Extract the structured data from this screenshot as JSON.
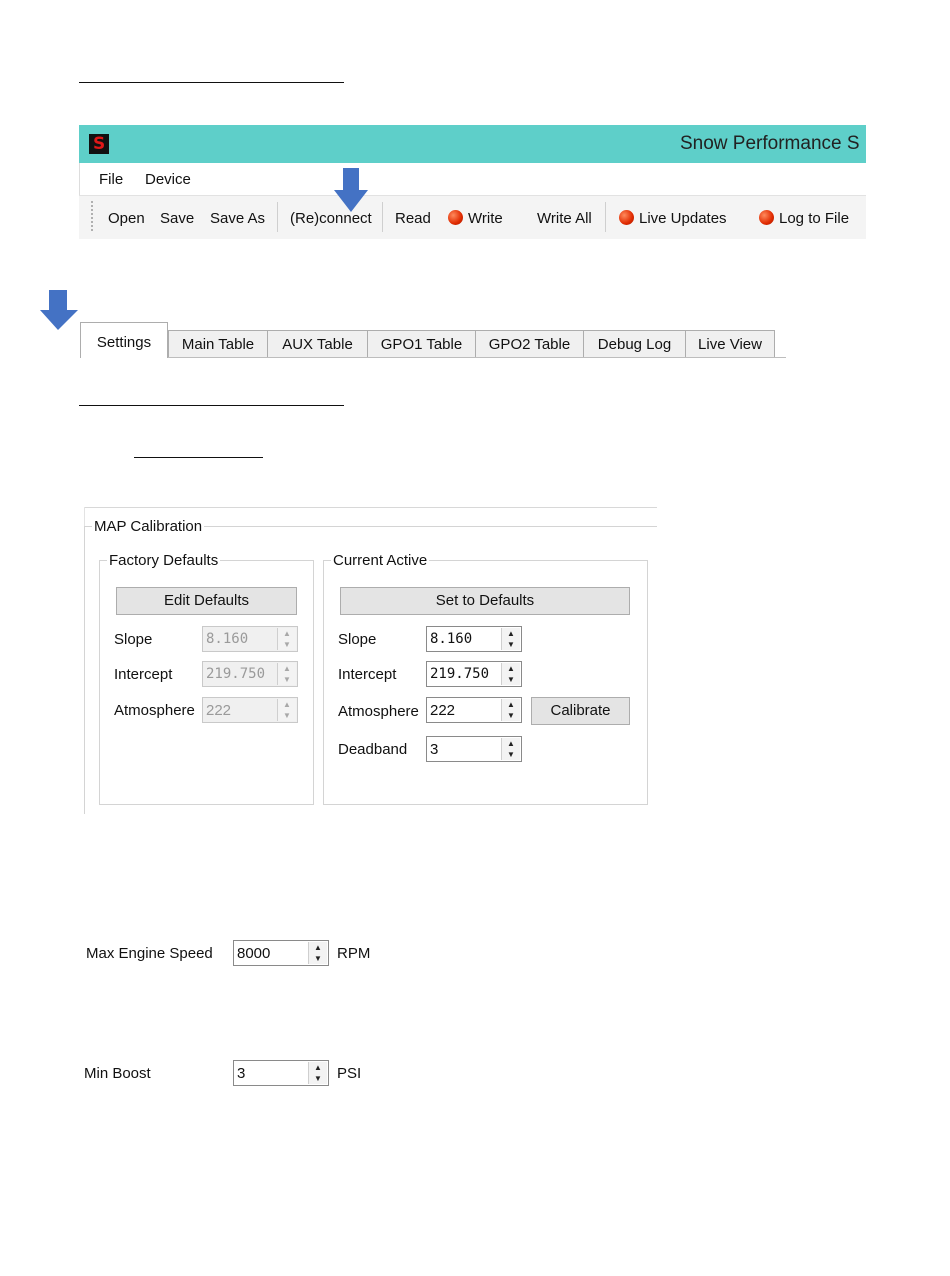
{
  "app": {
    "title": "Snow Performance S",
    "logo": "S",
    "menu": [
      "File",
      "Device"
    ],
    "toolbar": {
      "open": "Open",
      "save": "Save",
      "save_as": "Save As",
      "reconnect": "(Re)connect",
      "read": "Read",
      "write": "Write",
      "write_all": "Write All",
      "live_updates": "Live Updates",
      "log_to_file": "Log to File"
    }
  },
  "tabs": [
    "Settings",
    "Main Table",
    "AUX Table",
    "GPO1 Table",
    "GPO2 Table",
    "Debug Log",
    "Live View"
  ],
  "map_calibration": {
    "title": "MAP Calibration",
    "factory": {
      "title": "Factory Defaults",
      "button": "Edit Defaults",
      "slope_label": "Slope",
      "slope": "8.160",
      "intercept_label": "Intercept",
      "intercept": "219.750",
      "atmosphere_label": "Atmosphere",
      "atmosphere": "222"
    },
    "current": {
      "title": "Current Active",
      "button": "Set to Defaults",
      "slope_label": "Slope",
      "slope": "8.160",
      "intercept_label": "Intercept",
      "intercept": "219.750",
      "atmosphere_label": "Atmosphere",
      "atmosphere": "222",
      "calibrate": "Calibrate",
      "deadband_label": "Deadband",
      "deadband": "3"
    }
  },
  "engine": {
    "label": "Max Engine Speed",
    "value": "8000",
    "unit": "RPM"
  },
  "boost": {
    "label": "Min Boost",
    "value": "3",
    "unit": "PSI"
  },
  "colors": {
    "titlebar": "#5ecfc9",
    "arrow": "#4472c4",
    "led": "#e02a00"
  }
}
